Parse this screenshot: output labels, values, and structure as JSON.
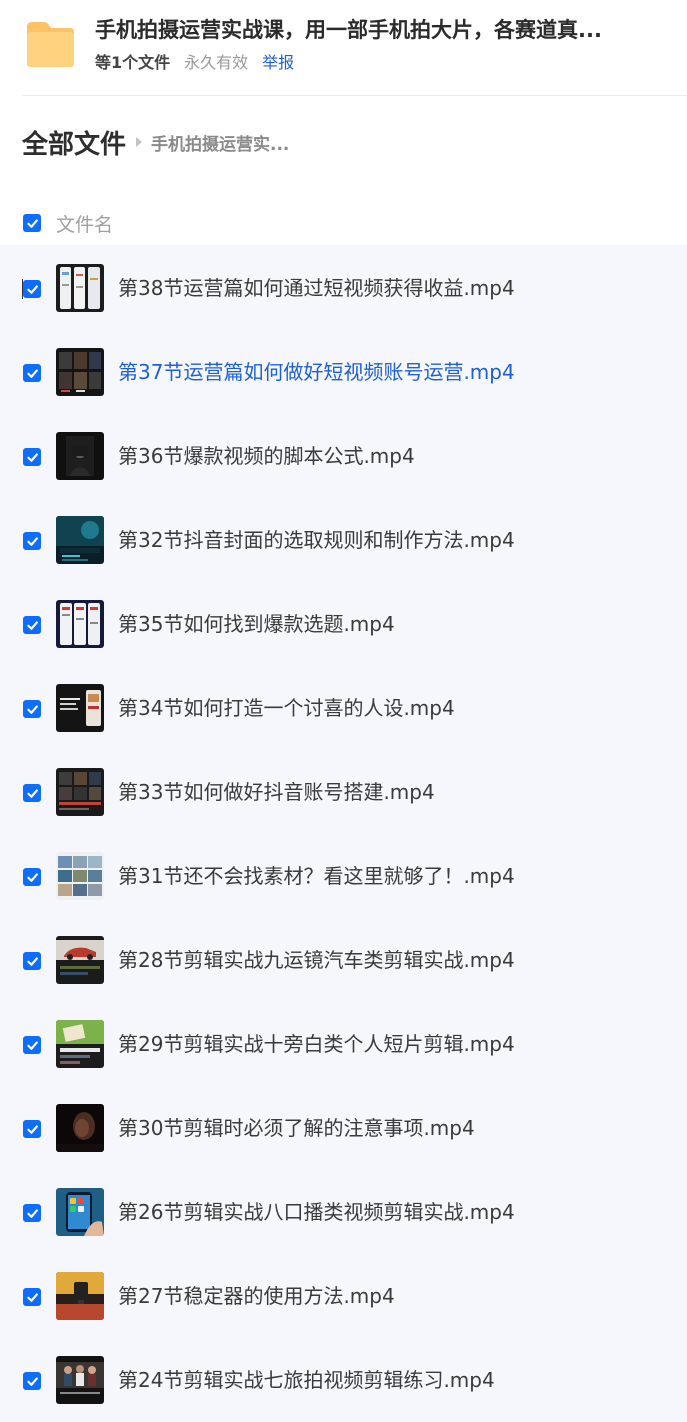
{
  "header": {
    "title": "手机拍摄运营实战课，用一部手机拍大片，各赛道真...",
    "file_count": "等1个文件",
    "validity": "永久有效",
    "report_label": "举报"
  },
  "breadcrumb": {
    "root": "全部文件",
    "current": "手机拍摄运营实..."
  },
  "table": {
    "column_header": "文件名"
  },
  "files": [
    {
      "name": "第38节运营篇如何通过短视频获得收益.mp4",
      "thumb": "phone-screens",
      "active": false
    },
    {
      "name": "第37节运营篇如何做好短视频账号运营.mp4",
      "thumb": "dark-grid",
      "active": true
    },
    {
      "name": "第36节爆款视频的脚本公式.mp4",
      "thumb": "portrait-dark",
      "active": false
    },
    {
      "name": "第32节抖音封面的选取规则和制作方法.mp4",
      "thumb": "cyan-cover",
      "active": false
    },
    {
      "name": "第35节如何找到爆款选题.mp4",
      "thumb": "phone-lists",
      "active": false
    },
    {
      "name": "第34节如何打造一个讨喜的人设.mp4",
      "thumb": "text-slide",
      "active": false
    },
    {
      "name": "第33节如何做好抖音账号搭建.mp4",
      "thumb": "profile-grid",
      "active": false
    },
    {
      "name": "第31节还不会找素材？看这里就够了！.mp4",
      "thumb": "landscape-grid",
      "active": false
    },
    {
      "name": "第28节剪辑实战九运镜汽车类剪辑实战.mp4",
      "thumb": "car-edit",
      "active": false
    },
    {
      "name": "第29节剪辑实战十旁白类个人短片剪辑.mp4",
      "thumb": "green-edit",
      "active": false
    },
    {
      "name": "第30节剪辑时必须了解的注意事项.mp4",
      "thumb": "dark-face",
      "active": false
    },
    {
      "name": "第26节剪辑实战八口播类视频剪辑实战.mp4",
      "thumb": "phone-hand",
      "active": false
    },
    {
      "name": "第27节稳定器的使用方法.mp4",
      "thumb": "gimbal",
      "active": false
    },
    {
      "name": "第24节剪辑实战七旅拍视频剪辑练习.mp4",
      "thumb": "travel-group",
      "active": false
    }
  ]
}
